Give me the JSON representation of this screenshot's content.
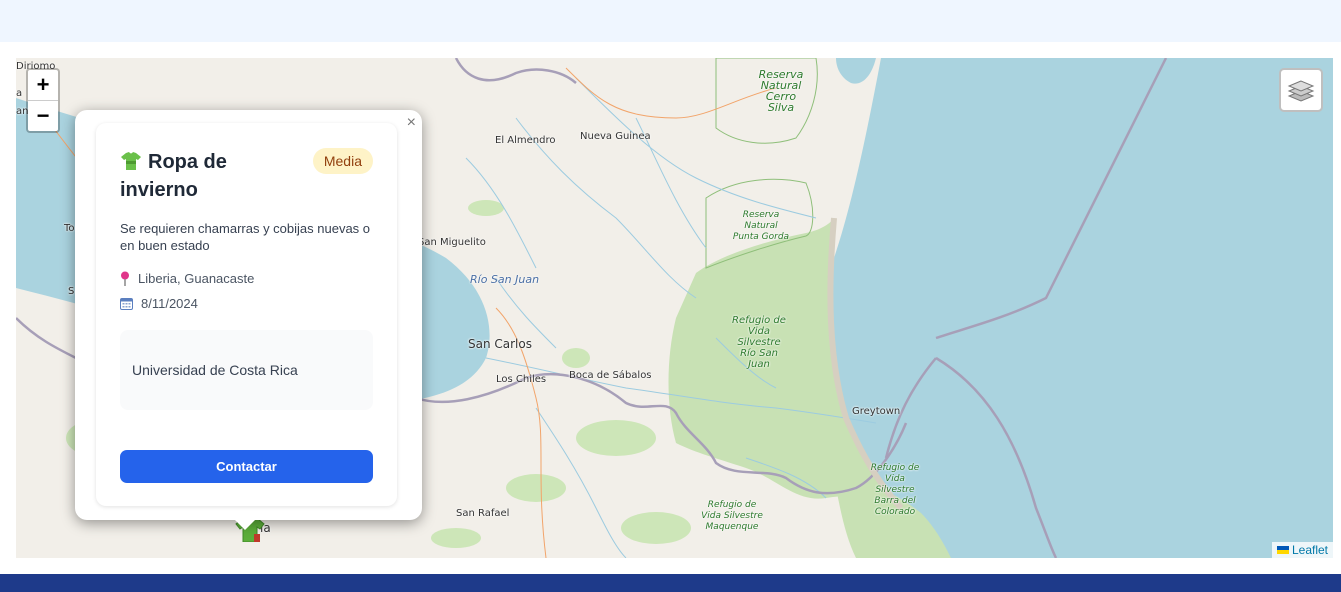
{
  "map": {
    "zoom_in_label": "+",
    "zoom_out_label": "−",
    "attribution": "Leaflet",
    "labels": {
      "reserva_cerro_silva": "Reserva Natural Cerro Silva",
      "reserva_punta_gorda": "Reserva Natural Punta Gorda",
      "refugio_rio_san_juan": "Refugio de Vida Silvestre Río San Juan",
      "refugio_barra_colorado": "Refugio de Vida Silvestre Barra del Colorado",
      "refugio_maquenque": "Refugio de Vida Silvestre Maquenque",
      "nueva_guinea": "Nueva Guinea",
      "el_almendro": "El Almendro",
      "san_miguelito": "San Miguelito",
      "rio_san_juan": "Río San Juan",
      "san_carlos": "San Carlos",
      "los_chiles": "Los Chiles",
      "boca_de_sabalos": "Boca de Sábalos",
      "greytown": "Greytown",
      "san_rafael": "San Rafael",
      "diriomo": "Diriomo",
      "edge_a": "a",
      "edge_an": "an",
      "edge_to": "To",
      "edge_s": "S",
      "edge_ia": "ia"
    }
  },
  "popup": {
    "close_label": "×",
    "title": "Ropa de invierno",
    "priority": "Media",
    "description": "Se requieren chamarras y cobijas nuevas o en buen estado",
    "location": "Liberia, Guanacaste",
    "date": "8/11/2024",
    "organization": "Universidad de Costa Rica",
    "contact_label": "Contactar"
  },
  "colors": {
    "primary": "#2563eb",
    "badge_bg": "#fef3c7",
    "badge_text": "#92400e",
    "footer": "#1e3a8a",
    "header_band": "#eff6ff",
    "park": "#c8e1b4",
    "water": "#aad3df",
    "land": "#f2efe9"
  }
}
